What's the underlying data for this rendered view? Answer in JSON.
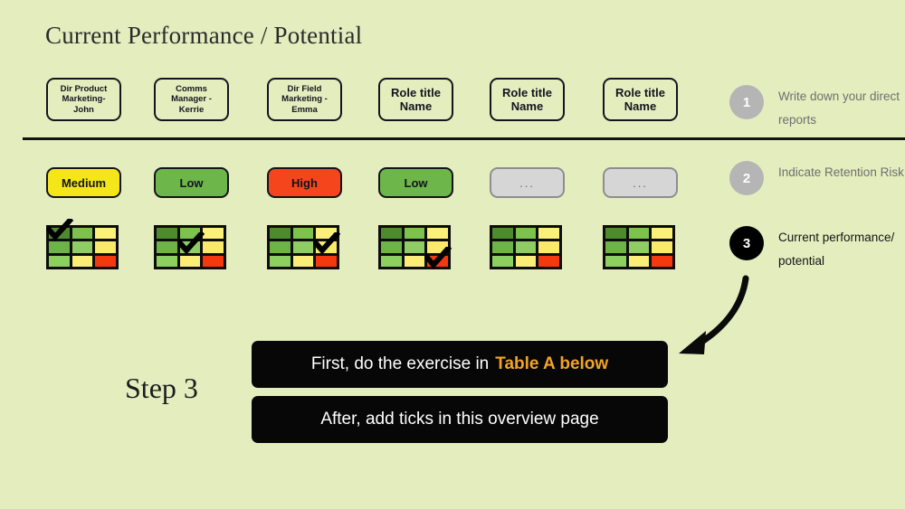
{
  "page": {
    "title": "Current Performance / Potential",
    "background_color": "#e4edbe",
    "step_label": "Step 3"
  },
  "columns": [
    {
      "name": "Dir Product Marketing- John",
      "name_size": "small",
      "risk": "Medium",
      "risk_color": "#f5e619",
      "tick": {
        "row": 0,
        "col": 0
      }
    },
    {
      "name": "Comms Manager - Kerrie",
      "name_size": "small",
      "risk": "Low",
      "risk_color": "#6cb64a",
      "tick": {
        "row": 1,
        "col": 1
      }
    },
    {
      "name": "Dir Field Marketing - Emma",
      "name_size": "small",
      "risk": "High",
      "risk_color": "#f4451d",
      "tick": {
        "row": 1,
        "col": 2
      }
    },
    {
      "name": "Role title Name",
      "name_size": "big",
      "risk": "Low",
      "risk_color": "#6cb64a",
      "tick": {
        "row": 2,
        "col": 2
      }
    },
    {
      "name": "Role title Name",
      "name_size": "big",
      "risk": "...",
      "risk_color": "#d6d6d6",
      "tick": null
    },
    {
      "name": "Role title Name",
      "name_size": "big",
      "risk": "...",
      "risk_color": "#d6d6d6",
      "tick": null
    }
  ],
  "grid_colors": [
    [
      "#4e8a2e",
      "#7dc24d",
      "#faf07a"
    ],
    [
      "#6eb348",
      "#8fcc63",
      "#fae96a"
    ],
    [
      "#8ed05f",
      "#faee79",
      "#f4390f"
    ]
  ],
  "steps": [
    {
      "number": "1",
      "text": "Write down your direct reports",
      "active": false
    },
    {
      "number": "2",
      "text": "Indicate Retention Risk",
      "active": false
    },
    {
      "number": "3",
      "text": "Current performance/ potential",
      "active": true
    }
  ],
  "banners": [
    {
      "text": "First, do the exercise in",
      "highlight": "Table A below",
      "highlight_color": "#f2a426"
    },
    {
      "text": "After, add ticks in this overview page",
      "highlight": "",
      "highlight_color": "#f2a426"
    }
  ]
}
